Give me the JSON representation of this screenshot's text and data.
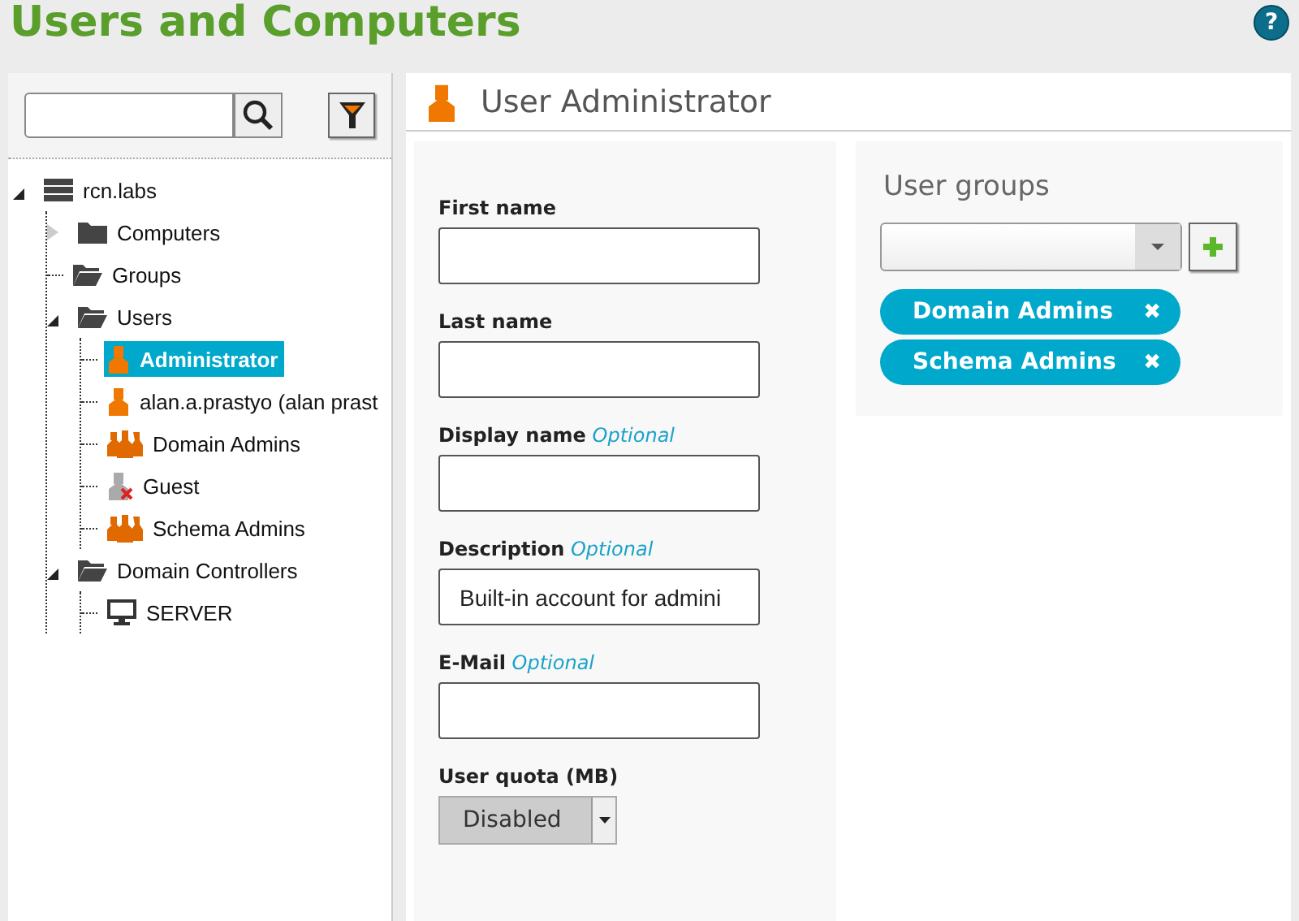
{
  "page": {
    "title": "Users and Computers",
    "help": "?"
  },
  "sidebar": {
    "tree": [
      {
        "label": "rcn.labs",
        "kind": "domain",
        "expanded": true,
        "selected": false,
        "children": [
          {
            "label": "Computers",
            "kind": "folder",
            "expanded": false,
            "selected": false
          },
          {
            "label": "Groups",
            "kind": "folder-open",
            "selected": false
          },
          {
            "label": "Users",
            "kind": "folder-open",
            "expanded": true,
            "selected": false,
            "children": [
              {
                "label": "Administrator",
                "kind": "user",
                "selected": true
              },
              {
                "label": "alan.a.prastyo (alan prast",
                "kind": "user",
                "selected": false
              },
              {
                "label": "Domain Admins",
                "kind": "group",
                "selected": false
              },
              {
                "label": "Guest",
                "kind": "user-disabled",
                "selected": false
              },
              {
                "label": "Schema Admins",
                "kind": "group",
                "selected": false
              }
            ]
          },
          {
            "label": "Domain Controllers",
            "kind": "folder-open",
            "expanded": true,
            "selected": false,
            "children": [
              {
                "label": "SERVER",
                "kind": "computer",
                "selected": false
              }
            ]
          }
        ]
      }
    ]
  },
  "detail": {
    "title": "User Administrator",
    "fields": [
      {
        "label": "First name"
      },
      {
        "label": "Last name"
      },
      {
        "label": "Display name",
        "optional": "Optional"
      },
      {
        "label": "Description",
        "optional": "Optional",
        "value": "Built-in account for admini"
      },
      {
        "label": "E-Mail",
        "optional": "Optional"
      }
    ],
    "quota": {
      "label": "User quota (MB)",
      "value": "Disabled"
    },
    "groups": {
      "title": "User groups",
      "tags": [
        {
          "label": "Domain Admins",
          "remove": "✖"
        },
        {
          "label": "Schema Admins",
          "remove": "✖"
        }
      ]
    }
  }
}
